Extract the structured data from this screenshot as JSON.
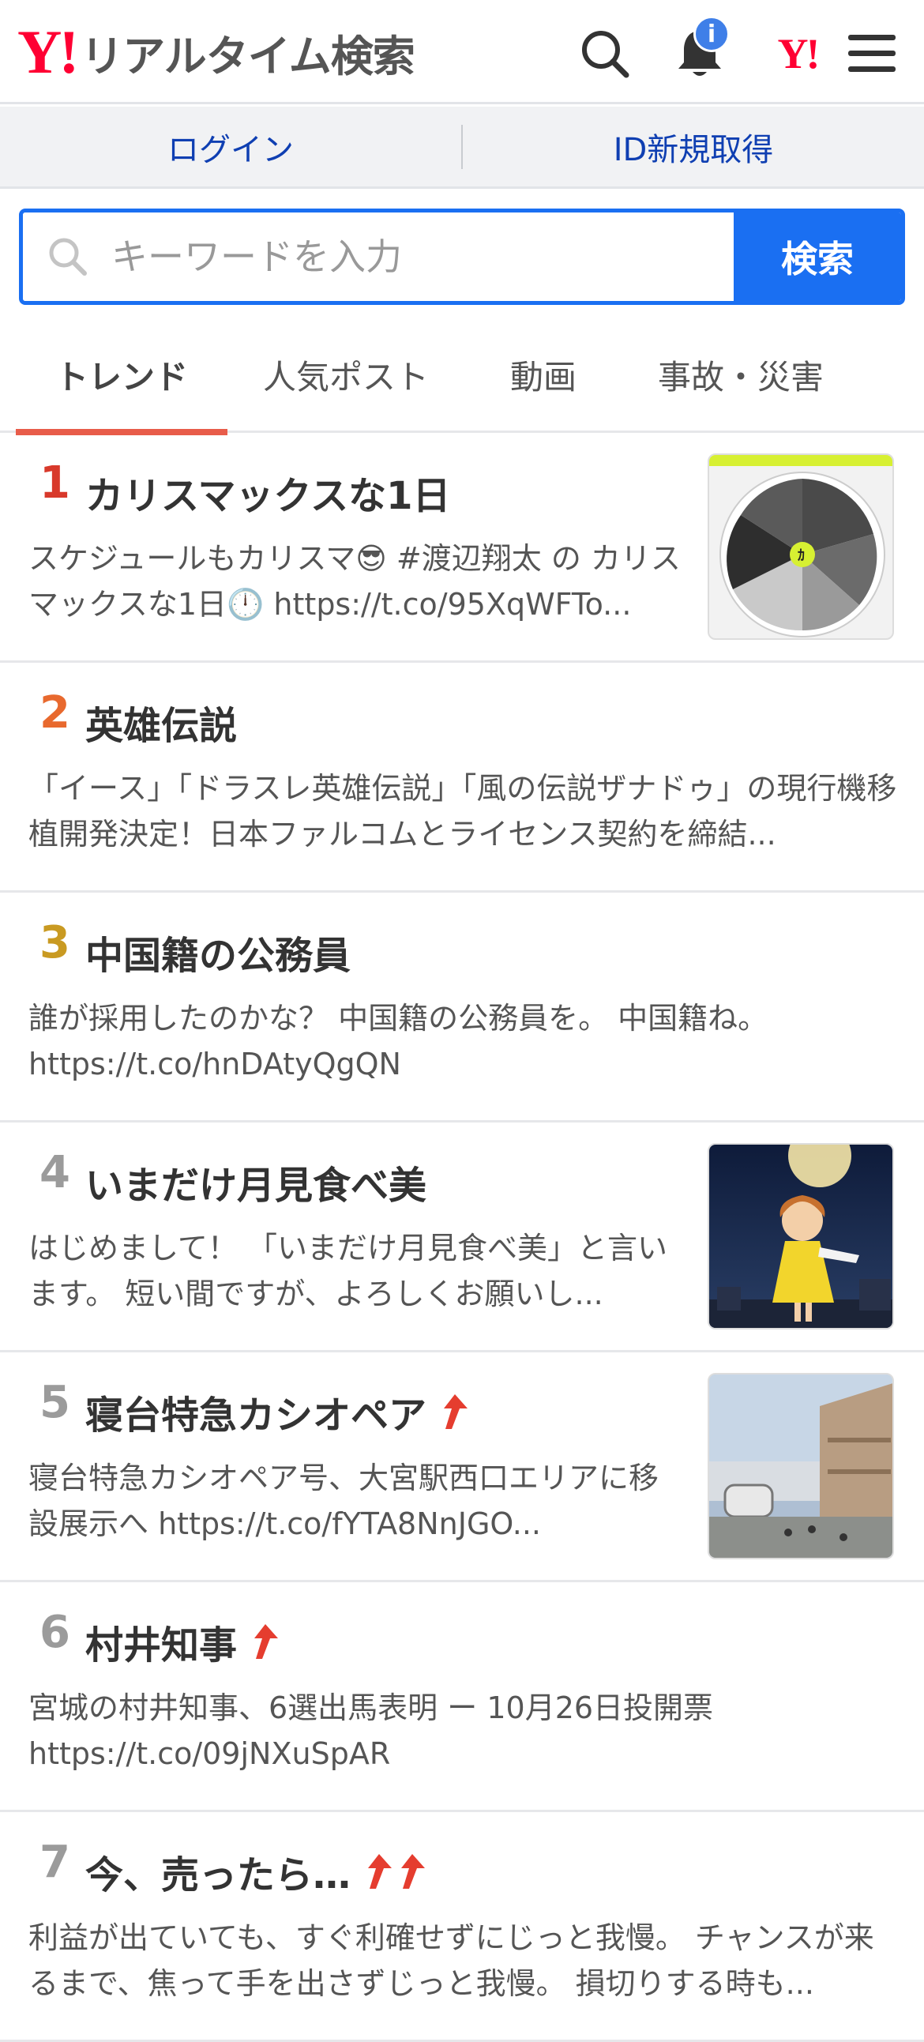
{
  "header": {
    "logo_mark": "Y!",
    "logo_text": "リアルタイム検索",
    "notification_badge": "i",
    "yahoo_mark": "Y!"
  },
  "login_bar": {
    "login": "ログイン",
    "register": "ID新規取得"
  },
  "search": {
    "placeholder": "キーワードを入力",
    "button": "検索"
  },
  "tabs": [
    {
      "label": "トレンド",
      "active": true
    },
    {
      "label": "人気ポスト",
      "active": false
    },
    {
      "label": "動画",
      "active": false
    },
    {
      "label": "事故・災害",
      "active": false
    }
  ],
  "colors": {
    "accent": "#1a6ff2",
    "rank1": "#d8392b",
    "rank2": "#e8692e",
    "rank3": "#c99a22",
    "rank_other": "#9b9b9b",
    "arrow": "#e53d2f"
  },
  "trends": [
    {
      "rank": "1",
      "title": "カリスマックスな1日",
      "arrows": 0,
      "thumb": "clock-chart-image",
      "desc": "スケジュールもカリスマ😎 #渡辺翔太 の カリスマックスな1日🕛 https://t.co/95XqWFTo..."
    },
    {
      "rank": "2",
      "title": "英雄伝説",
      "arrows": 0,
      "thumb": null,
      "desc": "「イース」「ドラスレ英雄伝説」「風の伝説ザナドゥ」の現行機移植開発決定！日本ファルコムとライセンス契約を締結..."
    },
    {
      "rank": "3",
      "title": "中国籍の公務員",
      "arrows": 0,
      "thumb": null,
      "desc": "誰が採用したのかな？ 中国籍の公務員を。 中国籍ね。 https://t.co/hnDAtyQgQN"
    },
    {
      "rank": "4",
      "title": "いまだけ月見食べ美",
      "arrows": 0,
      "thumb": "anime-character-image",
      "desc": "はじめまして！ 「いまだけ月見食べ美」と言います。 短い間ですが、よろしくお願いし..."
    },
    {
      "rank": "5",
      "title": "寝台特急カシオペア",
      "arrows": 1,
      "thumb": "train-station-image",
      "desc": "寝台特急カシオペア号、大宮駅西口エリアに移設展示へ https://t.co/fYTA8NnJGO..."
    },
    {
      "rank": "6",
      "title": "村井知事",
      "arrows": 1,
      "thumb": null,
      "desc": "宮城の村井知事、6選出馬表明 ー 10月26日投開票 https://t.co/09jNXuSpAR"
    },
    {
      "rank": "7",
      "title": "今、売ったら…",
      "arrows": 2,
      "thumb": null,
      "desc": "利益が出ていても、すぐ利確せずにじっと我慢。 チャンスが来るまで、焦って手を出さずじっと我慢。 損切りする時も..."
    }
  ]
}
